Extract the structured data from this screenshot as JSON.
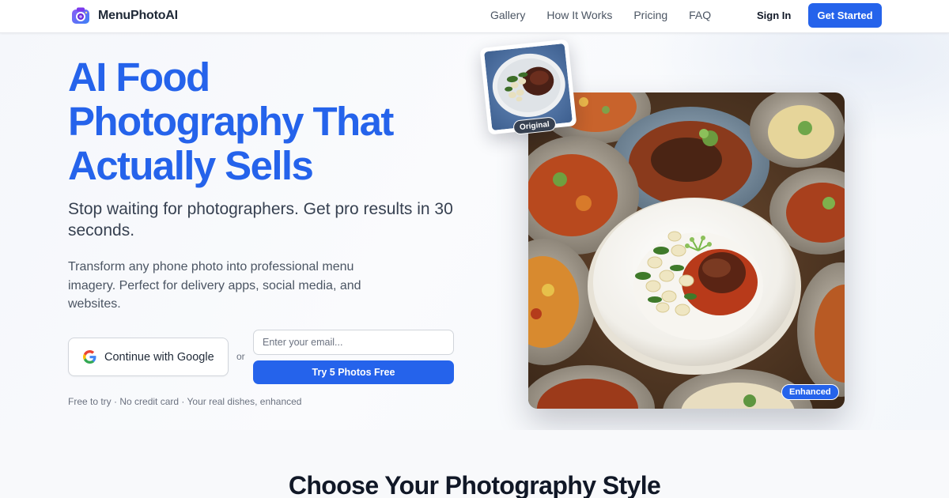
{
  "nav": {
    "brand": "MenuPhotoAI",
    "links": [
      "Gallery",
      "How It Works",
      "Pricing",
      "FAQ"
    ],
    "signin": "Sign In",
    "cta": "Get Started"
  },
  "hero": {
    "headline_lines": [
      "AI Food",
      "Photography That",
      "Actually Sells"
    ],
    "subhead": "Stop waiting for photographers. Get pro results in 30 seconds.",
    "description": "Transform any phone photo into professional menu imagery. Perfect for delivery apps, social media, and websites.",
    "google_button": "Continue with Google",
    "or": "or",
    "email_placeholder": "Enter your email...",
    "try_button": "Try 5 Photos Free",
    "fine_print": "Free to try · No credit card · Your real dishes, enhanced",
    "original_badge": "Original",
    "enhanced_badge": "Enhanced"
  },
  "section2": {
    "title": "Choose Your Photography Style"
  },
  "colors": {
    "accent": "#2563eb",
    "text_dark": "#111827",
    "text_muted": "#6b7280"
  }
}
